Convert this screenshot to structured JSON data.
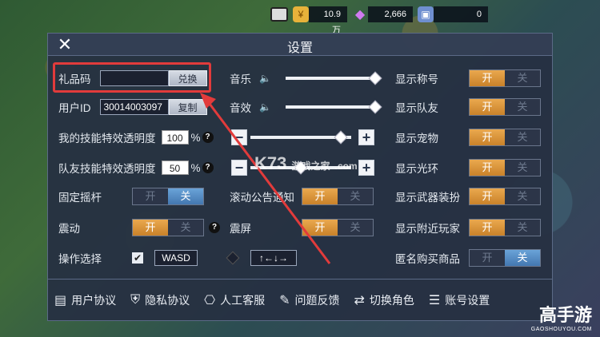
{
  "topbar": {
    "gold": "10.9万",
    "gems": "2,666",
    "tickets": "0"
  },
  "dialog": {
    "title": "设置",
    "gift": {
      "label": "礼品码",
      "value": "",
      "button": "兑换"
    },
    "user": {
      "label": "用户ID",
      "value": "30014003097",
      "button": "复制"
    },
    "skill_alpha": {
      "label": "我的技能特效透明度",
      "value": "100",
      "unit": "%",
      "level": 0.9
    },
    "team_alpha": {
      "label": "队友技能特效透明度",
      "value": "50",
      "unit": "%",
      "level": 0.5
    },
    "joystick": {
      "label": "固定摇杆",
      "on": "开",
      "off": "关",
      "state": "off"
    },
    "vibrate": {
      "label": "震动",
      "on": "开",
      "off": "关",
      "state": "on"
    },
    "control": {
      "label": "操作选择",
      "opt1": "WASD",
      "opt2": "↑←↓→",
      "selected": "WASD"
    },
    "music": {
      "label": "音乐",
      "level": 1.0
    },
    "sfx": {
      "label": "音效",
      "level": 1.0
    },
    "scroll_notice": {
      "label": "滚动公告通知",
      "on": "开",
      "off": "关",
      "state": "on"
    },
    "shake": {
      "label": "震屏",
      "on": "开",
      "off": "关",
      "state": "on"
    },
    "right": [
      {
        "label": "显示称号",
        "on": "开",
        "off": "关",
        "state": "on"
      },
      {
        "label": "显示队友",
        "on": "开",
        "off": "关",
        "state": "on"
      },
      {
        "label": "显示宠物",
        "on": "开",
        "off": "关",
        "state": "on"
      },
      {
        "label": "显示光环",
        "on": "开",
        "off": "关",
        "state": "on"
      },
      {
        "label": "显示武器装扮",
        "on": "开",
        "off": "关",
        "state": "on"
      },
      {
        "label": "显示附近玩家",
        "on": "开",
        "off": "关",
        "state": "on"
      },
      {
        "label": "匿名购买商品",
        "on": "开",
        "off": "关",
        "state": "off"
      }
    ],
    "footer": [
      {
        "label": "用户协议",
        "icon": "document-icon"
      },
      {
        "label": "隐私协议",
        "icon": "shield-icon"
      },
      {
        "label": "人工客服",
        "icon": "support-icon"
      },
      {
        "label": "问题反馈",
        "icon": "feedback-icon"
      },
      {
        "label": "切换角色",
        "icon": "switch-user-icon"
      },
      {
        "label": "账号设置",
        "icon": "list-icon"
      }
    ]
  },
  "overlay": {
    "watermark": "K73",
    "watermark_sub": "游戏之家",
    "watermark_domain": ".com",
    "brand": "高手游",
    "brand_url": "GAOSHOUYOU.COM"
  },
  "colors": {
    "accent_on": "#e09a3f",
    "accent_blue": "#4f86c0",
    "highlight": "#e23b3b"
  }
}
